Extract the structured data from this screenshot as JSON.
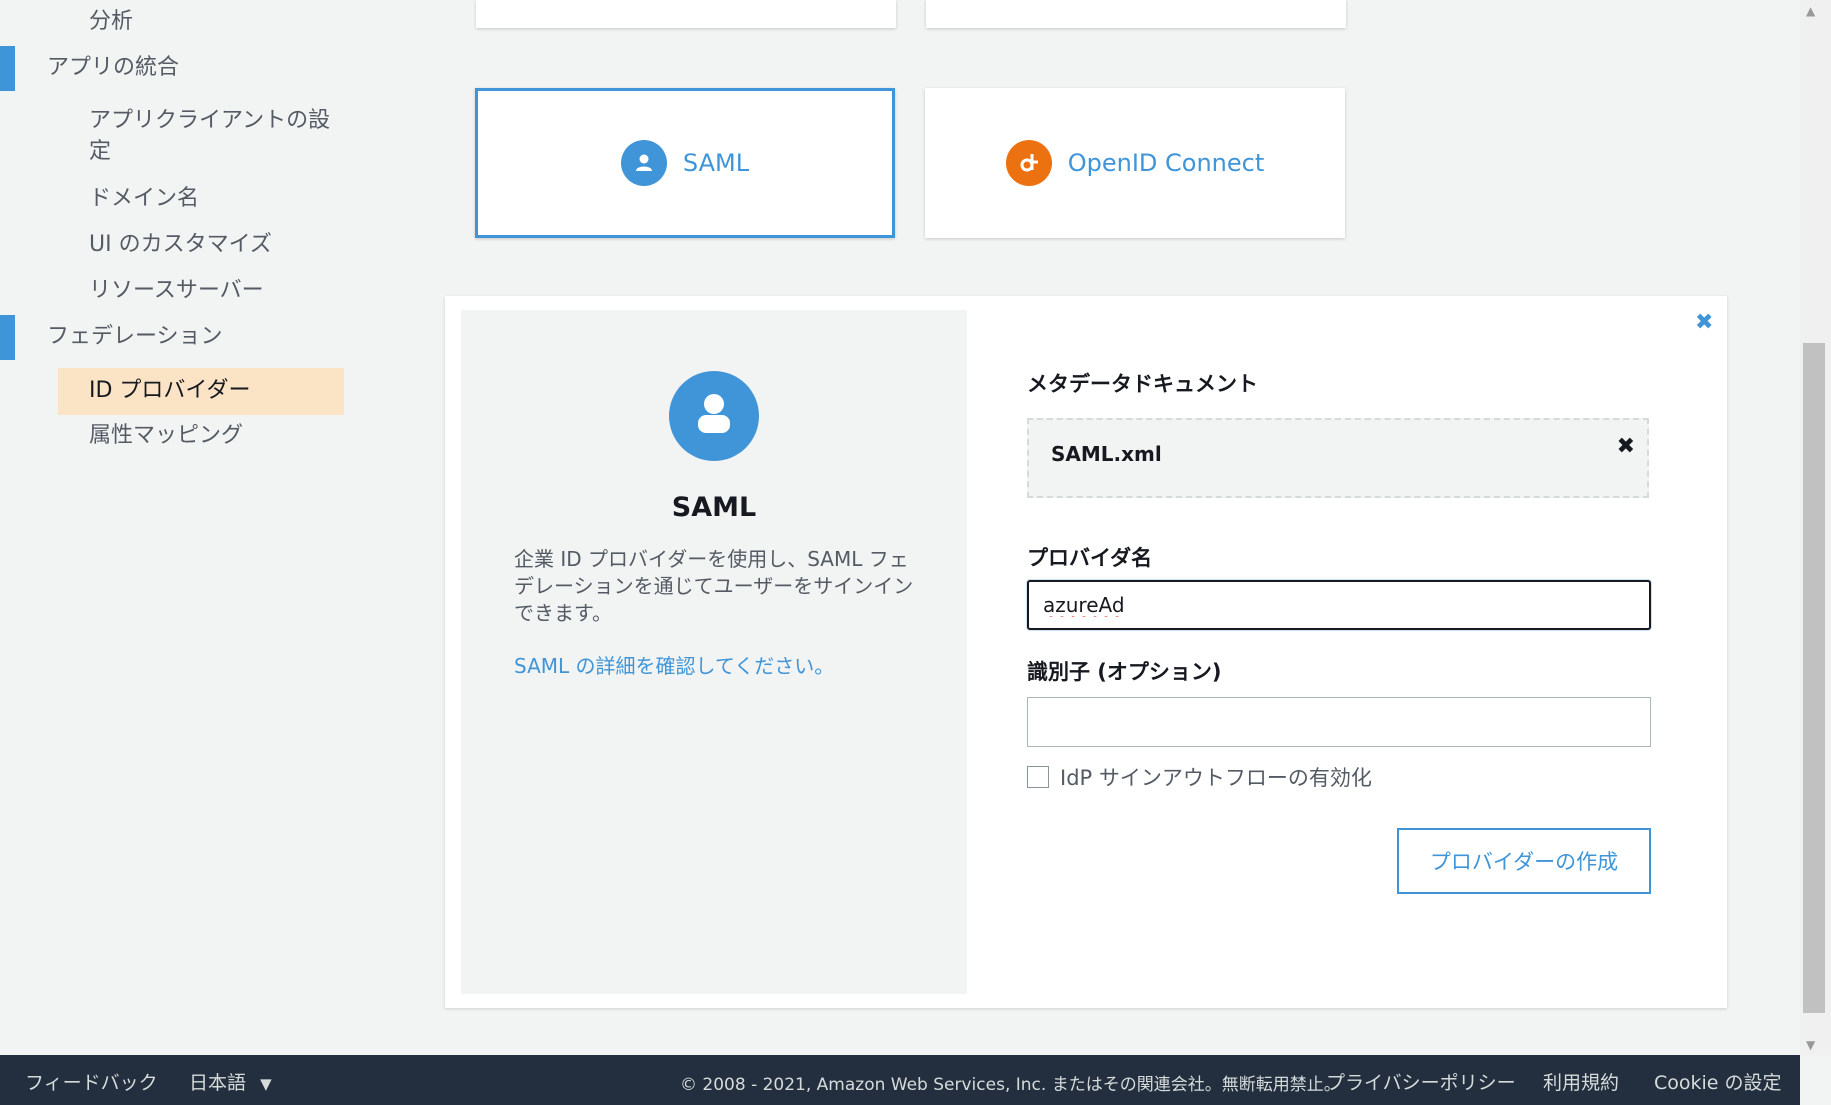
{
  "sidebar": {
    "items": [
      {
        "label": "分析"
      },
      {
        "label": "アプリの統合"
      },
      {
        "label": "アプリクライアントの設定"
      },
      {
        "label": "ドメイン名"
      },
      {
        "label": "UI のカスタマイズ"
      },
      {
        "label": "リソースサーバー"
      },
      {
        "label": "フェデレーション"
      },
      {
        "label": "ID プロバイダー"
      },
      {
        "label": "属性マッピング"
      }
    ],
    "active_item": "ID プロバイダー"
  },
  "tiles": [
    {
      "label": "SAML",
      "icon": "user-icon",
      "color": "#3f95d8",
      "selected": true
    },
    {
      "label": "OpenID Connect",
      "icon": "openid-icon",
      "color": "#ec7211",
      "selected": false
    }
  ],
  "panel": {
    "title": "SAML",
    "description": "企業 ID プロバイダーを使用し、SAML フェデレーションを通じてユーザーをサインインできます。",
    "link": "SAML の詳細を確認してください。",
    "metadata_label": "メタデータドキュメント",
    "metadata_file": "SAML.xml",
    "provider_name_label": "プロバイダ名",
    "provider_name_value": "azureAd",
    "identifier_label": "識別子 (オプション)",
    "identifier_value": "",
    "checkbox_label": "IdP サインアウトフローの有効化",
    "checkbox_checked": false,
    "create_button": "プロバイダーの作成"
  },
  "footer": {
    "feedback": "フィードバック",
    "language": "日本語",
    "copyright": "© 2008 - 2021, Amazon Web Services, Inc. またはその関連会社。無断転用禁止。",
    "privacy": "プライバシーポリシー",
    "terms": "利用規約",
    "cookie": "Cookie の設定"
  },
  "colors": {
    "accent": "#3f95d8",
    "openid_orange": "#ec7211",
    "active_nav_bg": "#fbe4c6",
    "footer_bg": "#232f3e"
  }
}
